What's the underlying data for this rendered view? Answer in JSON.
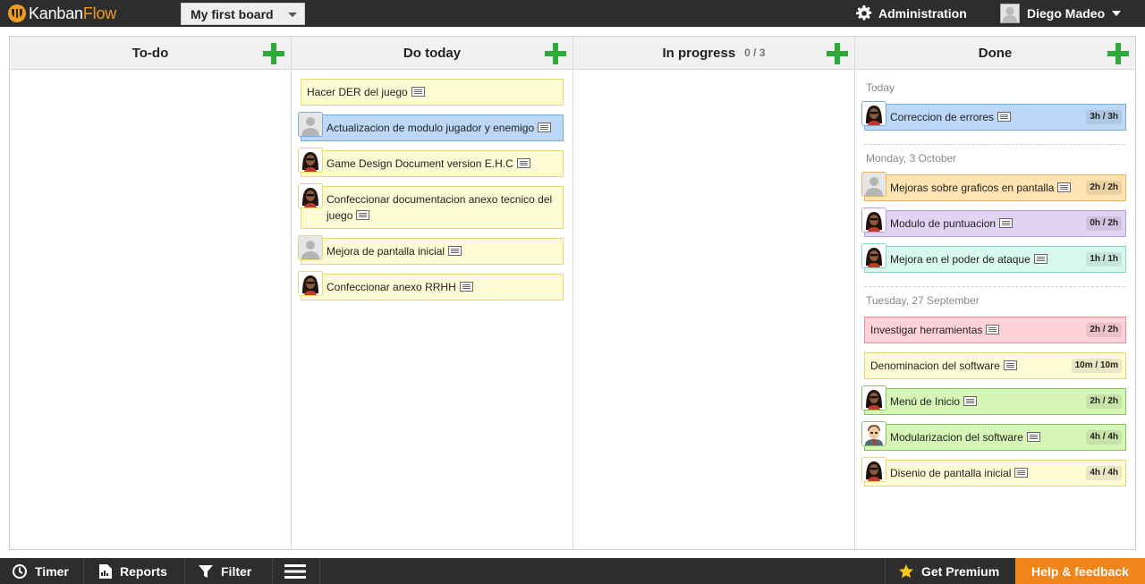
{
  "app": {
    "logo_part1": "Kanban",
    "logo_part2": "Flow"
  },
  "header": {
    "board_name": "My first board",
    "admin_label": "Administration",
    "user_name": "Diego Madeo"
  },
  "columns": [
    {
      "title": "To-do"
    },
    {
      "title": "Do today"
    },
    {
      "title": "In progress",
      "wip": "0 / 3"
    },
    {
      "title": "Done"
    }
  ],
  "do_today_tasks": [
    {
      "text": "Hacer DER del juego",
      "color": "yellow",
      "avatar": "none"
    },
    {
      "text": "Actualizacion de modulo jugador y enemigo",
      "color": "blue",
      "avatar": "placeholder"
    },
    {
      "text": "Game Design Document version E.H.C",
      "color": "yellow",
      "avatar": "dark-hair"
    },
    {
      "text": "Confeccionar documentacion anexo tecnico del juego",
      "color": "yellow",
      "avatar": "dark-hair"
    },
    {
      "text": "Mejora de pantalla inicial",
      "color": "yellow",
      "avatar": "placeholder"
    },
    {
      "text": "Confeccionar anexo RRHH",
      "color": "yellow",
      "avatar": "dark-hair"
    }
  ],
  "done": {
    "groups": [
      {
        "label": "Today"
      },
      {
        "label": "Monday, 3 October"
      },
      {
        "label": "Tuesday, 27 September"
      }
    ],
    "tasks": [
      {
        "text": "Correccion de errores",
        "time": "3h / 3h",
        "color": "blue",
        "avatar": "dark-hair"
      },
      {
        "text": "Mejoras sobre graficos en pantalla",
        "time": "2h / 2h",
        "color": "orange",
        "avatar": "placeholder"
      },
      {
        "text": "Modulo de puntuacion",
        "time": "0h / 2h",
        "color": "purple",
        "avatar": "dark-hair"
      },
      {
        "text": "Mejora en el poder de ataque",
        "time": "1h / 1h",
        "color": "mint",
        "avatar": "dark-hair"
      },
      {
        "text": "Investigar herramientas",
        "time": "2h / 2h",
        "color": "pink",
        "avatar": "none"
      },
      {
        "text": "Denominacion del software",
        "time": "10m / 10m",
        "color": "yellow",
        "avatar": "none"
      },
      {
        "text": "Menú de Inicio",
        "time": "2h / 2h",
        "color": "green",
        "avatar": "dark-hair"
      },
      {
        "text": "Modularizacion del software",
        "time": "4h / 4h",
        "color": "green",
        "avatar": "man"
      },
      {
        "text": "Disenio de pantalla inicial",
        "time": "4h / 4h",
        "color": "yellow",
        "avatar": "dark-hair"
      }
    ]
  },
  "footer": {
    "timer": "Timer",
    "reports": "Reports",
    "filter": "Filter",
    "premium": "Get Premium",
    "help": "Help & feedback"
  },
  "icons": {
    "gear": "gear-icon",
    "note": "description-icon",
    "add": "plus-icon",
    "timer": "clock-icon",
    "reports": "report-icon",
    "filter": "funnel-icon",
    "menu": "hamburger-icon",
    "premium": "star-icon"
  },
  "colors": {
    "topbar": "#2d2d2d",
    "brand_orange": "#f29b1d",
    "add_green": "#2eaa3b",
    "help_orange": "#f0851b"
  }
}
